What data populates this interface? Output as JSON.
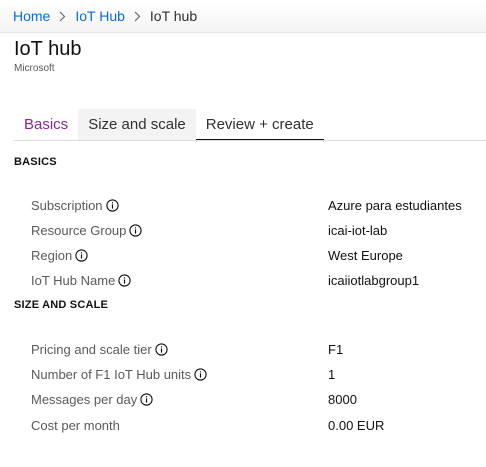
{
  "breadcrumb": {
    "items": [
      "Home",
      "IoT Hub",
      "IoT hub"
    ]
  },
  "header": {
    "title": "IoT hub",
    "subtitle": "Microsoft"
  },
  "tabs": [
    {
      "label": "Basics",
      "state": "visited"
    },
    {
      "label": "Size and scale",
      "state": "hover"
    },
    {
      "label": "Review + create",
      "state": "active"
    }
  ],
  "basics": {
    "header": "BASICS",
    "rows": [
      {
        "label": "Subscription",
        "value": "Azure para estudiantes"
      },
      {
        "label": "Resource Group",
        "value": "icai-iot-lab"
      },
      {
        "label": "Region",
        "value": "West Europe"
      },
      {
        "label": "IoT Hub Name",
        "value": "icaiiotlabgroup1"
      }
    ]
  },
  "size_scale": {
    "header": "SIZE AND SCALE",
    "rows": [
      {
        "label": "Pricing and scale tier",
        "value": "F1"
      },
      {
        "label": "Number of F1 IoT Hub units",
        "value": "1"
      },
      {
        "label": "Messages per day",
        "value": "8000"
      },
      {
        "label": "Cost per month",
        "value": "0.00 EUR"
      }
    ]
  },
  "colors": {
    "link": "#0a6cd6",
    "visited_tab": "#8a2796",
    "active_tab_underline": "#111111"
  },
  "icons": {
    "separator": "chevron-right-icon",
    "info": "info-icon"
  }
}
